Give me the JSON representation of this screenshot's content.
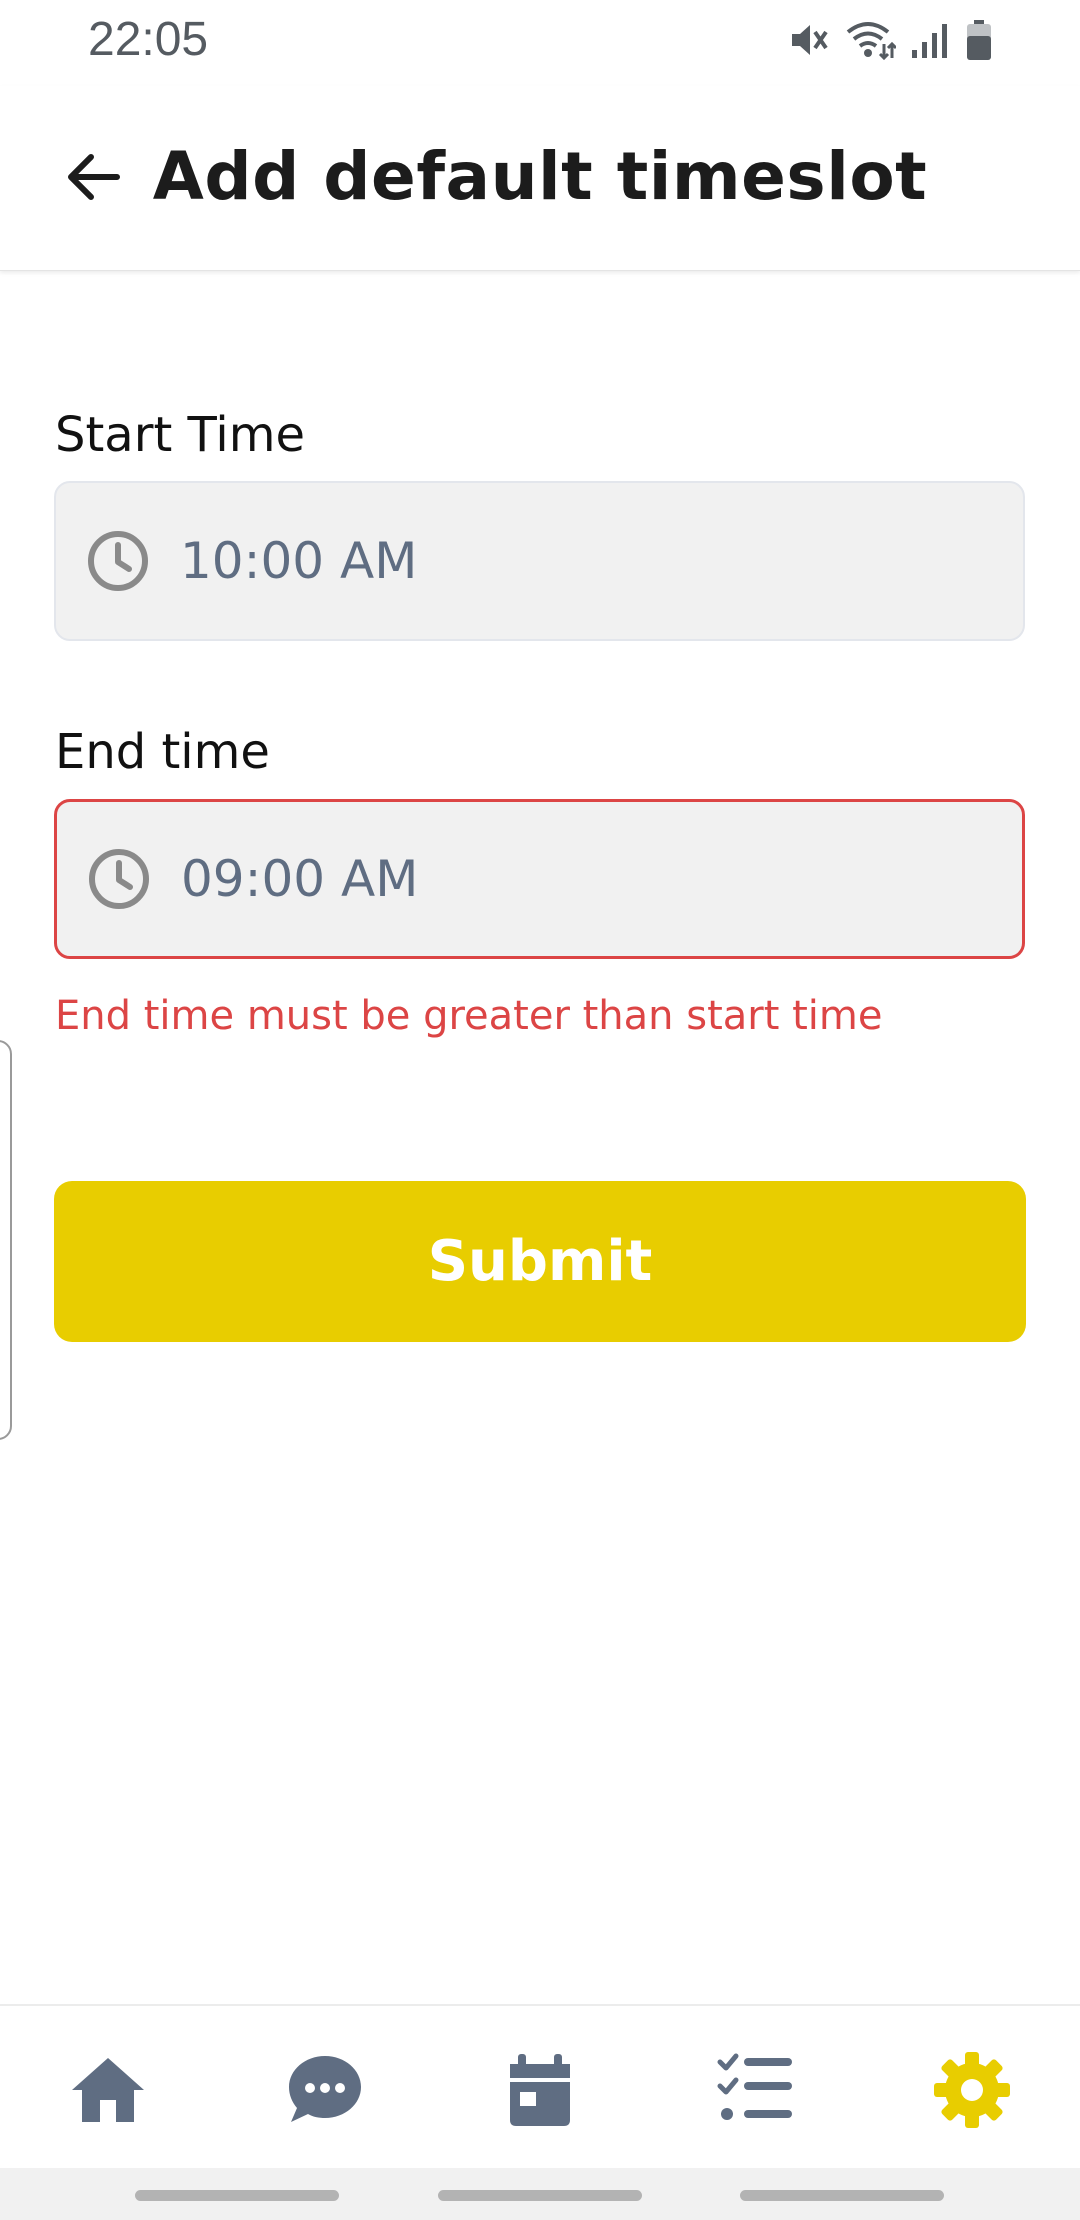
{
  "status_bar": {
    "time": "22:05",
    "icons": [
      "mute-icon",
      "wifi-icon",
      "signal-icon",
      "battery-icon"
    ]
  },
  "app_bar": {
    "title": "Add default timeslot",
    "back_icon": "arrow-left-icon"
  },
  "form": {
    "start_time": {
      "label": "Start Time",
      "value": "10:00 AM",
      "icon": "clock-icon"
    },
    "end_time": {
      "label": "End time",
      "value": "09:00 AM",
      "icon": "clock-icon",
      "error": "End time must be greater than start time"
    },
    "submit_label": "Submit"
  },
  "bottom_nav": {
    "items": [
      {
        "icon": "home-icon",
        "active": false
      },
      {
        "icon": "chat-icon",
        "active": false
      },
      {
        "icon": "calendar-icon",
        "active": false
      },
      {
        "icon": "tasks-icon",
        "active": false
      },
      {
        "icon": "gear-icon",
        "active": true
      }
    ]
  },
  "colors": {
    "accent": "#e8cd00",
    "error": "#dc4545",
    "nav_inactive": "#5f6d82",
    "input_text": "#5f6d82"
  }
}
